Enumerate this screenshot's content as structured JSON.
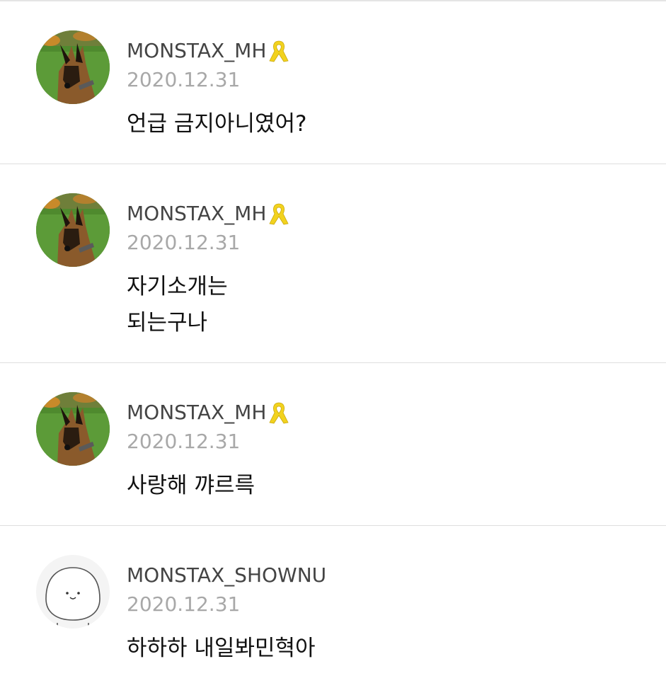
{
  "comments": [
    {
      "author": "MONSTAX_MH",
      "badge_icon": "yellow-ribbon-icon",
      "avatar_icon": "dog-photo-avatar",
      "date": "2020.12.31",
      "lines": [
        "언급 금지아니였어?"
      ]
    },
    {
      "author": "MONSTAX_MH",
      "badge_icon": "yellow-ribbon-icon",
      "avatar_icon": "dog-photo-avatar",
      "date": "2020.12.31",
      "lines": [
        "자기소개는",
        "되는구나"
      ]
    },
    {
      "author": "MONSTAX_MH",
      "badge_icon": "yellow-ribbon-icon",
      "avatar_icon": "dog-photo-avatar",
      "date": "2020.12.31",
      "lines": [
        "사랑해 꺄르륵"
      ]
    },
    {
      "author": "MONSTAX_SHOWNU",
      "badge_icon": "",
      "avatar_icon": "cartoon-character-avatar",
      "date": "2020.12.31",
      "lines": [
        "하하하 내일봐민혁아"
      ]
    }
  ],
  "colors": {
    "author": "#444444",
    "date": "#a8a8a8",
    "text": "#111111",
    "divider": "#dedede",
    "ribbon": "#f2d21e"
  }
}
